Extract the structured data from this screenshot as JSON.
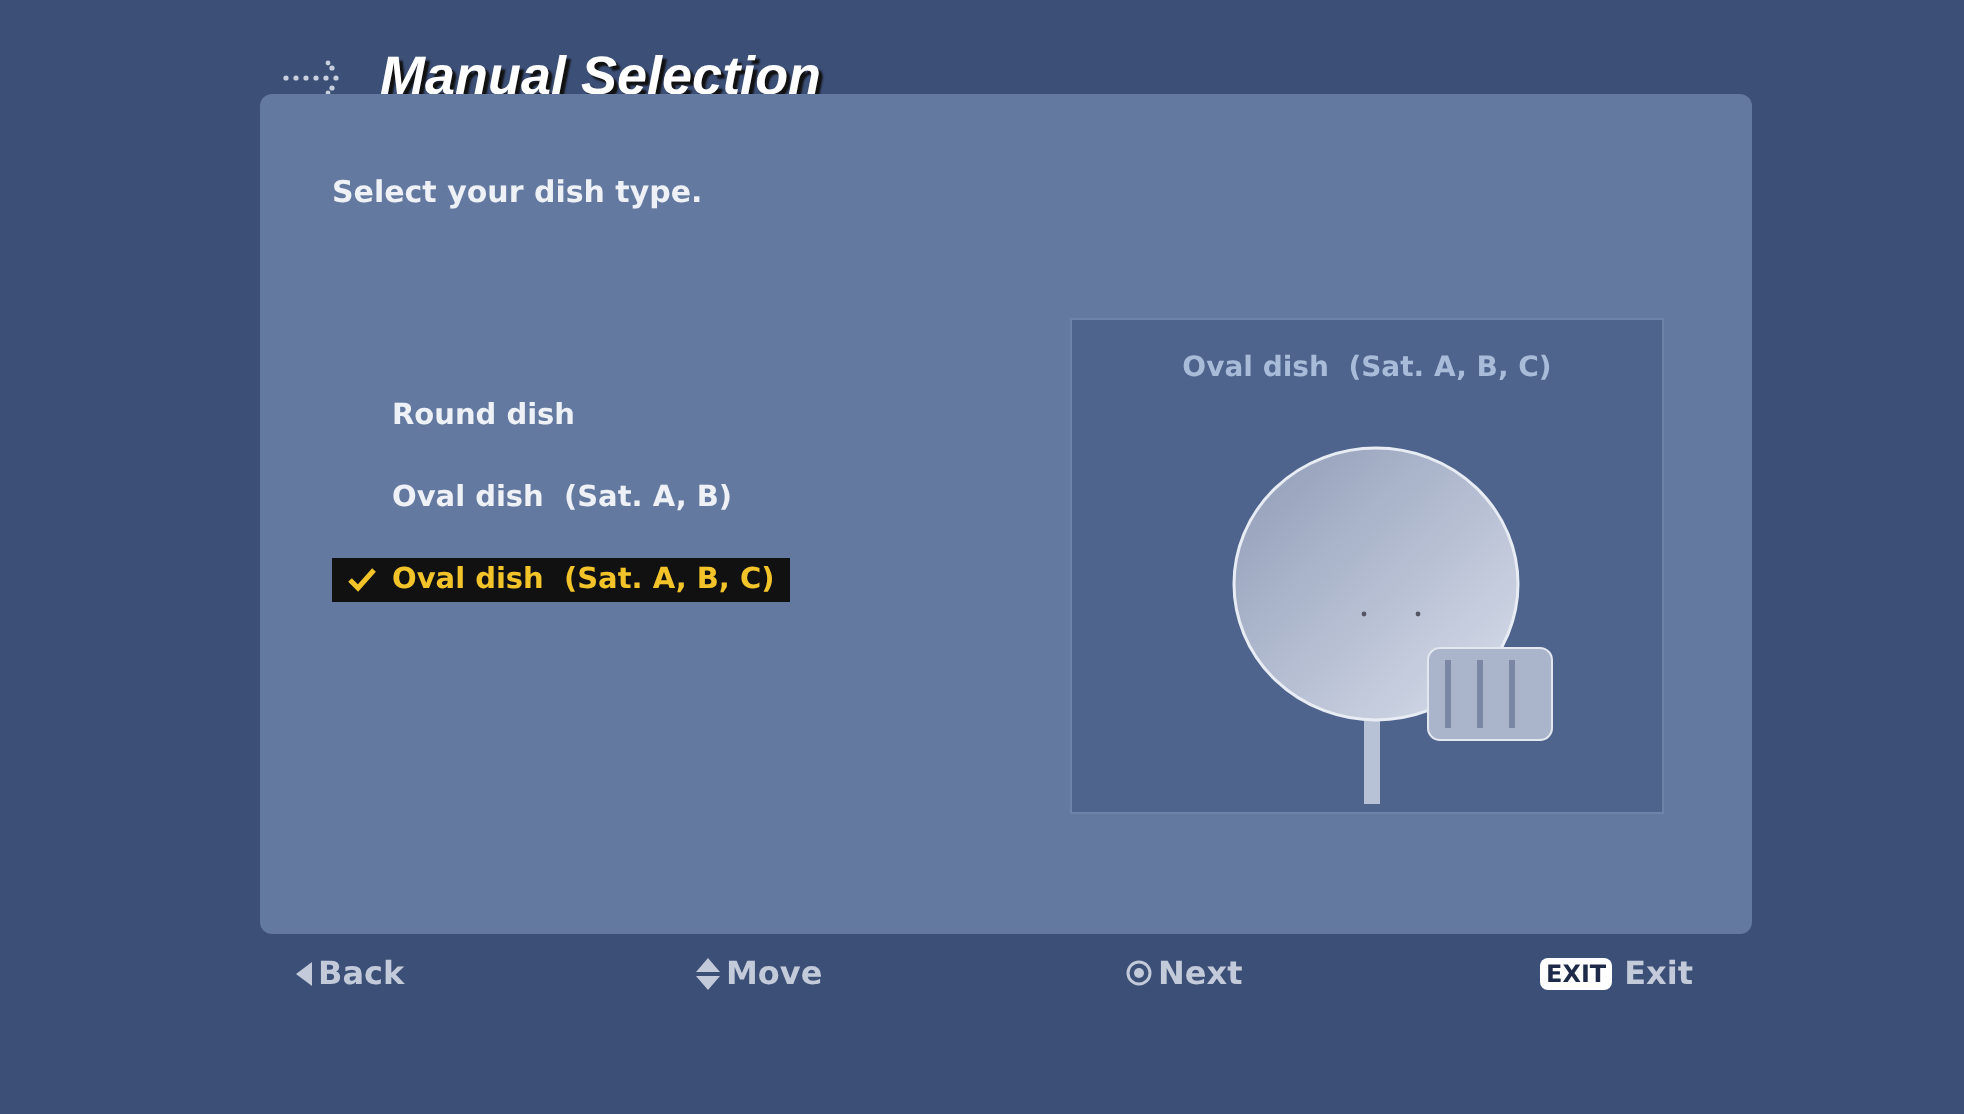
{
  "title": "Manual Selection",
  "prompt": "Select your dish type.",
  "options": [
    {
      "label": "Round dish",
      "selected": false
    },
    {
      "label": "Oval dish  (Sat. A, B)",
      "selected": false
    },
    {
      "label": "Oval dish  (Sat. A, B, C)",
      "selected": true
    }
  ],
  "preview": {
    "caption": "Oval dish  (Sat. A, B, C)"
  },
  "footer": [
    {
      "kind": "back",
      "label": "Back"
    },
    {
      "kind": "move",
      "label": "Move"
    },
    {
      "kind": "next",
      "label": "Next"
    },
    {
      "kind": "exit",
      "key": "EXIT",
      "label": "Exit"
    }
  ]
}
